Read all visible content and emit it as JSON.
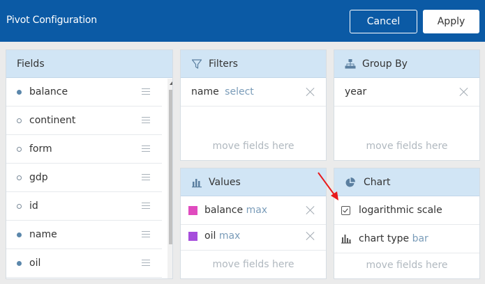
{
  "header": {
    "title": "Pivot Configuration",
    "cancel_label": "Cancel",
    "apply_label": "Apply"
  },
  "fields": {
    "title": "Fields",
    "items": [
      {
        "label": "balance",
        "used": true
      },
      {
        "label": "continent",
        "used": false
      },
      {
        "label": "form",
        "used": false
      },
      {
        "label": "gdp",
        "used": false
      },
      {
        "label": "id",
        "used": false
      },
      {
        "label": "name",
        "used": true
      },
      {
        "label": "oil",
        "used": true
      }
    ]
  },
  "filters": {
    "title": "Filters",
    "items": [
      {
        "label": "name",
        "sub": "select"
      }
    ],
    "placeholder": "move fields here"
  },
  "group_by": {
    "title": "Group By",
    "items": [
      {
        "label": "year"
      }
    ],
    "placeholder": "move fields here"
  },
  "values": {
    "title": "Values",
    "items": [
      {
        "label": "balance",
        "sub": "max",
        "color": "#e04bbf"
      },
      {
        "label": "oil",
        "sub": "max",
        "color": "#a64ddc"
      }
    ],
    "placeholder": "move fields here"
  },
  "chart": {
    "title": "Chart",
    "log_scale_label": "logarithmic scale",
    "log_scale_checked": true,
    "chart_type_label": "chart type",
    "chart_type_value": "bar",
    "placeholder": "move fields here"
  },
  "colors": {
    "header_bg": "#0b5aa5",
    "panel_head_bg": "#d1e5f5",
    "accent_text": "#7a9cb9",
    "annotation_arrow": "#e8191c"
  }
}
